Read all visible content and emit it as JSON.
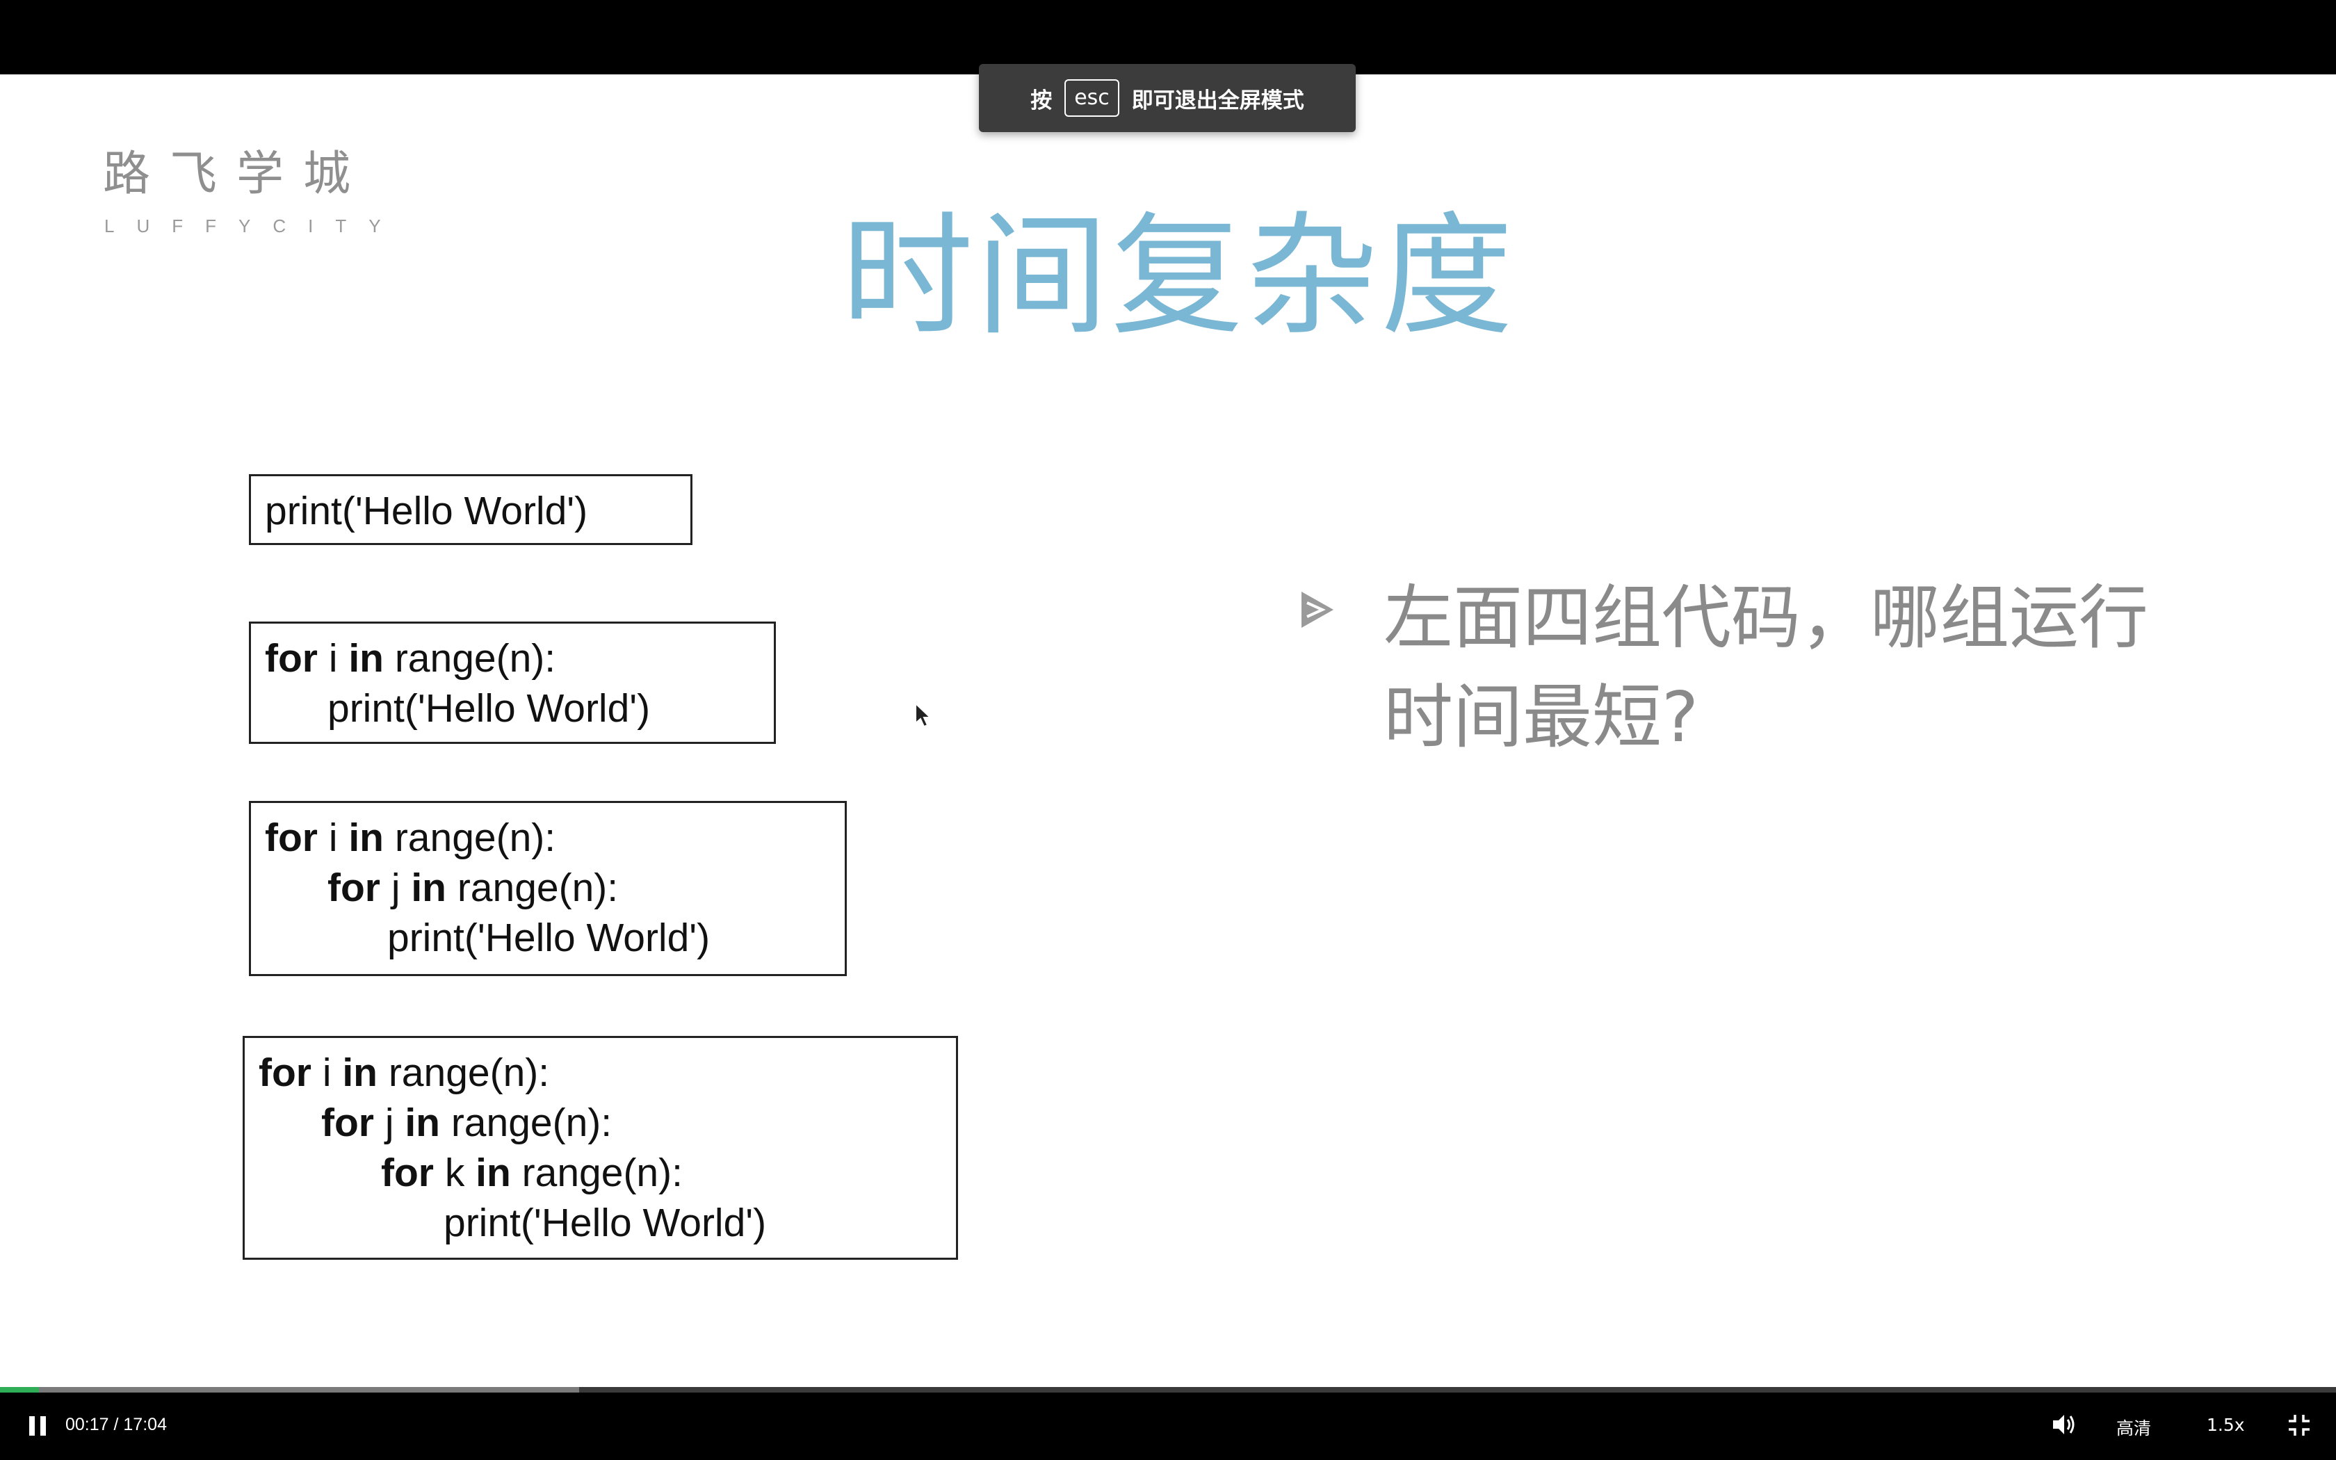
{
  "toast": {
    "prefix": "按",
    "key": "esc",
    "suffix": "即可退出全屏模式"
  },
  "logo": {
    "cn": "路飞学城",
    "en": "LUFFYCITY"
  },
  "slide": {
    "title": "时间复杂度",
    "question_line1": "左面四组代码，哪组运行",
    "question_line2": "时间最短?",
    "code": {
      "print_stmt": "print('Hello World')",
      "kw_for": "for",
      "kw_in": "in",
      "var_i": " i ",
      "var_j": " j ",
      "var_k": " k ",
      "range_call": " range(n):"
    }
  },
  "player": {
    "current_time": "00:17",
    "separator": " / ",
    "duration": "17:04",
    "progress_fraction": 0.0166,
    "buffered_fraction": 0.248,
    "quality": "高清",
    "speed": "1.5x",
    "icons": [
      "pause-icon",
      "volume-icon",
      "exit-fullscreen-icon"
    ],
    "colors": {
      "progress": "#2fae57",
      "title": "#7ab7d4"
    }
  }
}
